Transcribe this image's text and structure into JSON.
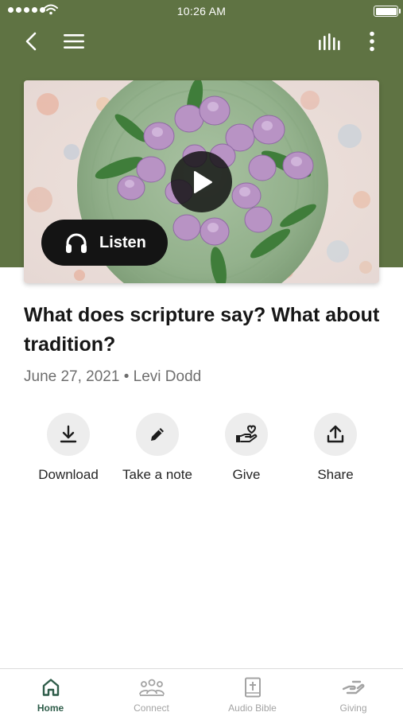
{
  "status_bar": {
    "time": "10:26 AM",
    "signal_icon": "cellular-signal-icon",
    "wifi_icon": "wifi-icon",
    "battery_icon": "battery-icon"
  },
  "header": {
    "back_icon": "chevron-left-icon",
    "menu_icon": "hamburger-menu-icon",
    "audio_icon": "audio-bars-icon",
    "more_icon": "more-vertical-icon"
  },
  "hero": {
    "image": "tulip-bouquet-photo",
    "play_icon": "play-icon",
    "listen_label": "Listen",
    "listen_icon": "headphones-icon"
  },
  "content": {
    "title": "What does scripture say? What about tradition?",
    "meta": "June 27, 2021 • Levi Dodd"
  },
  "actions": [
    {
      "label": "Download",
      "icon": "download-icon"
    },
    {
      "label": "Take a note",
      "icon": "pencil-icon"
    },
    {
      "label": "Give",
      "icon": "give-hand-heart-icon"
    },
    {
      "label": "Share",
      "icon": "share-icon"
    }
  ],
  "tabs": [
    {
      "label": "Home",
      "icon": "home-icon",
      "active": true
    },
    {
      "label": "Connect",
      "icon": "people-icon",
      "active": false
    },
    {
      "label": "Audio Bible",
      "icon": "bible-icon",
      "active": false
    },
    {
      "label": "Giving",
      "icon": "giving-hand-icon",
      "active": false
    }
  ],
  "colors": {
    "header_green": "#5f7343",
    "active_tab": "#2f5d4a",
    "inactive_tab": "#a3a3a3"
  }
}
